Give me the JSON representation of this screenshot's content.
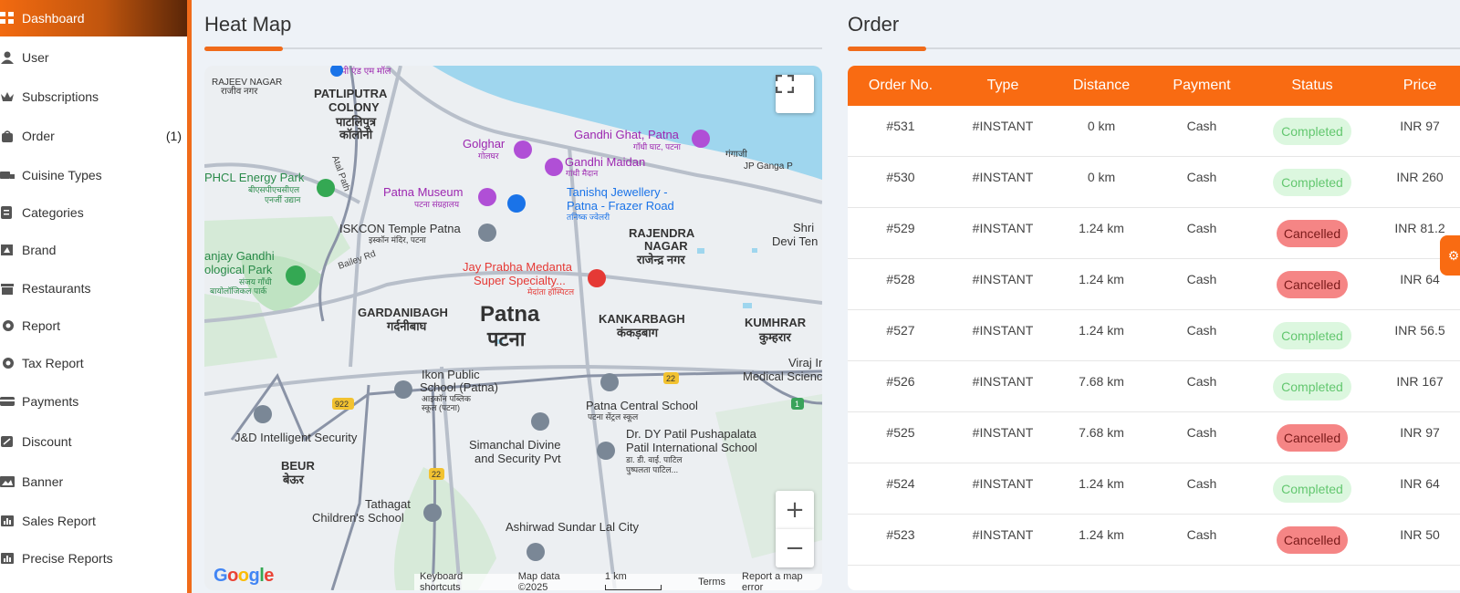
{
  "sidebar": {
    "items": [
      {
        "label": "Dashboard",
        "icon": "grid-icon",
        "active": true
      },
      {
        "label": "User",
        "icon": "user-icon"
      },
      {
        "label": "Subscriptions",
        "icon": "crown-icon"
      },
      {
        "label": "Order",
        "icon": "bag-icon",
        "badge": "(1)"
      },
      {
        "label": "Cuisine Types",
        "icon": "truck-icon"
      },
      {
        "label": "Categories",
        "icon": "categories-icon"
      },
      {
        "label": "Brand",
        "icon": "brand-icon"
      },
      {
        "label": "Restaurants",
        "icon": "store-icon"
      },
      {
        "label": "Report",
        "icon": "report-icon"
      },
      {
        "label": "Tax Report",
        "icon": "tax-icon"
      },
      {
        "label": "Payments",
        "icon": "payments-icon"
      },
      {
        "label": "Discount",
        "icon": "discount-icon"
      },
      {
        "label": "Banner",
        "icon": "banner-icon"
      },
      {
        "label": "Sales Report",
        "icon": "chart-icon"
      },
      {
        "label": "Precise Reports",
        "icon": "precise-chart-icon"
      }
    ]
  },
  "heatmap": {
    "title": "Heat Map",
    "labels": {
      "rajeev": "RAJEEV NAGAR",
      "rajeev_hi": "राजीव नगर",
      "pdmall": "पी एंड एम मॉल",
      "patliputra": "PATLIPUTRA",
      "colony": "COLONY",
      "patliputra_hi": "पाटलिपुत्र",
      "colony_hi": "कॉलोनी",
      "golghar": "Golghar",
      "golghar_hi": "गोलघर",
      "gandhighat": "Gandhi Ghat, Patna",
      "gandhighat_hi": "गाँधी घाट, पटना",
      "gangaji": "गंगाजी",
      "jpganga": "JP Ganga P",
      "gandhimaidan": "Gandhi Maidan",
      "gandhimaidan_hi": "गांधी मैदान",
      "ecopark": "PHCL Energy Park",
      "ecopark_hi": "बीएसपीएचसीएल",
      "ecopark_hi2": "एनर्जी उद्यान",
      "atalpath": "Atal Path",
      "museum": "Patna Museum",
      "museum_hi": "पटना संग्रहालय",
      "tanishq": "Tanishq Jewellery -",
      "tanishq2": "Patna - Frazer Road",
      "tanishq_hi": "तनिष्क ज्वेलरी",
      "iskcon": "ISKCON Temple Patna",
      "iskcon_hi": "इस्कॉन मंदिर, पटना",
      "rajendra": "RAJENDRA",
      "nagar": "NAGAR",
      "rajendra_hi": "राजेन्द्र नगर",
      "shri": "Shri",
      "devi": "Devi Ten",
      "sanjay": "anjay Gandhi",
      "bio": "ological Park",
      "sanjay_hi": "संजय गाँधी",
      "bio_hi": "बायोलॉजिकल पार्क",
      "bailey": "Bailey Rd",
      "jayprabha": "Jay Prabha Medanta",
      "superspec": "Super Specialty...",
      "jayprabha_hi": "मेदांता हॉस्पिटल",
      "gardani": "GARDANIBAGH",
      "gardani_hi": "गर्दनीबाघ",
      "patna": "Patna",
      "patna_hi": "पटना",
      "kankar": "KANKARBAGH",
      "kankar_hi": "कंकड़बाग",
      "kumhrar": "KUMHRAR",
      "kumhrar_hi": "कुम्हरार",
      "viraj": "Viraj Ins",
      "medical": "Medical Science",
      "ikon": "Ikon Public",
      "ikon2": "School (Patna)",
      "ikon_hi": "आइकॉन पब्लिक",
      "ikon_hi2": "स्कूल (पटना)",
      "central": "Patna Central School",
      "central_hi": "पटना सेंट्रल स्कूल",
      "r22a": "22",
      "r922": "922",
      "r1": "1",
      "jd": "J&D Intelligent Security",
      "simanchal": "Simanchal Divine",
      "simanchal2": "and Security Pvt",
      "dy": "Dr. DY Patil Pushapalata",
      "dy2": "Patil International School",
      "dy_hi": "डा. डी. वाई. पाटिल",
      "dy_hi2": "पुष्पलता पाटिल...",
      "beur": "BEUR",
      "beur_hi": "बेऊर",
      "r22b": "22",
      "tathagat": "Tathagat",
      "children": "Children's School",
      "ashirwad": "Ashirwad Sundar Lal City"
    },
    "footer": {
      "shortcuts": "Keyboard shortcuts",
      "mapdata": "Map data ©2025",
      "scale": "1 km",
      "terms": "Terms",
      "report": "Report a map error"
    },
    "google": [
      "G",
      "o",
      "o",
      "g",
      "l",
      "e"
    ]
  },
  "order": {
    "title": "Order",
    "columns": [
      "Order No.",
      "Type",
      "Distance",
      "Payment",
      "Status",
      "Price"
    ],
    "rows": [
      {
        "no": "#531",
        "type": "#INSTANT",
        "distance": "0 km",
        "payment": "Cash",
        "status": "Completed",
        "price": "INR 97"
      },
      {
        "no": "#530",
        "type": "#INSTANT",
        "distance": "0 km",
        "payment": "Cash",
        "status": "Completed",
        "price": "INR 260"
      },
      {
        "no": "#529",
        "type": "#INSTANT",
        "distance": "1.24 km",
        "payment": "Cash",
        "status": "Cancelled",
        "price": "INR 81.2"
      },
      {
        "no": "#528",
        "type": "#INSTANT",
        "distance": "1.24 km",
        "payment": "Cash",
        "status": "Cancelled",
        "price": "INR 64"
      },
      {
        "no": "#527",
        "type": "#INSTANT",
        "distance": "1.24 km",
        "payment": "Cash",
        "status": "Completed",
        "price": "INR 56.5"
      },
      {
        "no": "#526",
        "type": "#INSTANT",
        "distance": "7.68 km",
        "payment": "Cash",
        "status": "Completed",
        "price": "INR 167"
      },
      {
        "no": "#525",
        "type": "#INSTANT",
        "distance": "7.68 km",
        "payment": "Cash",
        "status": "Cancelled",
        "price": "INR 97"
      },
      {
        "no": "#524",
        "type": "#INSTANT",
        "distance": "1.24 km",
        "payment": "Cash",
        "status": "Completed",
        "price": "INR 64"
      },
      {
        "no": "#523",
        "type": "#INSTANT",
        "distance": "1.24 km",
        "payment": "Cash",
        "status": "Cancelled",
        "price": "INR 50"
      }
    ]
  },
  "colors": {
    "accent": "#f96b12",
    "completed_bg": "#dcf7df",
    "completed_fg": "#63c76f",
    "cancelled_bg": "#f58585"
  }
}
